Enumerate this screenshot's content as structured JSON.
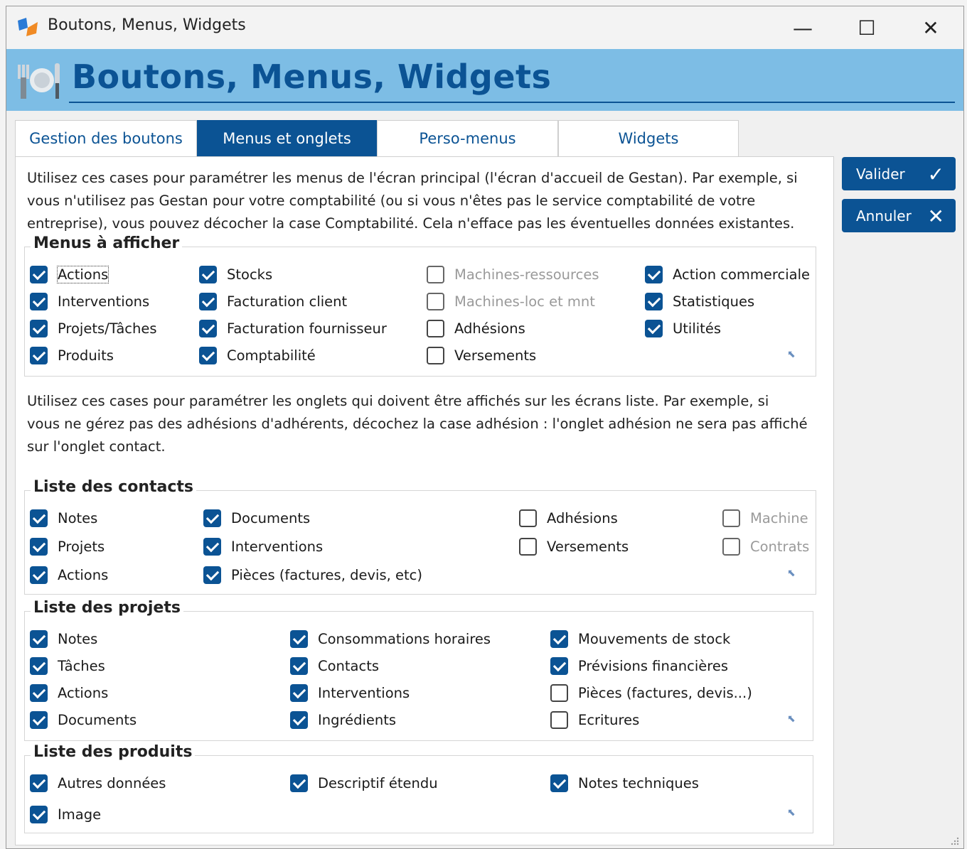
{
  "window": {
    "title": "Boutons, Menus, Widgets",
    "minimize": "—",
    "maximize": "☐",
    "close": "✕"
  },
  "banner": {
    "title": "Boutons, Menus, Widgets"
  },
  "tabs": [
    {
      "label": "Gestion des boutons"
    },
    {
      "label": "Menus et onglets"
    },
    {
      "label": "Perso-menus"
    },
    {
      "label": "Widgets"
    }
  ],
  "intro_menus": [
    "Utilisez ces cases pour paramétrer les menus de l'écran principal (l'écran d'accueil de Gestan). Par exemple, si",
    "vous n'utilisez pas Gestan pour votre comptabilité (ou si vous n'êtes pas le service comptabilité de votre",
    "entreprise), vous pouvez décocher la case Comptabilité. Cela n'efface pas les éventuelles données existantes."
  ],
  "intro_onglets": [
    "Utilisez ces cases pour paramétrer les onglets qui doivent être affichés sur les écrans liste. Par exemple, si",
    "vous ne gérez pas des adhésions d'adhérents, décochez la case adhésion : l'onglet adhésion ne sera pas affiché",
    "sur l'onglet contact."
  ],
  "groups": {
    "menus": {
      "title": "Menus à afficher",
      "items": [
        {
          "label": "Actions",
          "state": "on"
        },
        {
          "label": "Interventions",
          "state": "on"
        },
        {
          "label": "Projets/Tâches",
          "state": "on"
        },
        {
          "label": "Produits",
          "state": "on"
        },
        {
          "label": "Stocks",
          "state": "on"
        },
        {
          "label": "Facturation client",
          "state": "on"
        },
        {
          "label": "Facturation fournisseur",
          "state": "on"
        },
        {
          "label": "Comptabilité",
          "state": "on"
        },
        {
          "label": "Machines-ressources",
          "state": "disabled"
        },
        {
          "label": "Machines-loc et mnt",
          "state": "disabled"
        },
        {
          "label": "Adhésions",
          "state": "off"
        },
        {
          "label": "Versements",
          "state": "off"
        },
        {
          "label": "Action commerciale",
          "state": "on"
        },
        {
          "label": "Statistiques",
          "state": "on"
        },
        {
          "label": "Utilités",
          "state": "on"
        }
      ]
    },
    "contacts": {
      "title": "Liste des contacts",
      "items": [
        {
          "label": "Notes",
          "state": "on"
        },
        {
          "label": "Projets",
          "state": "on"
        },
        {
          "label": "Actions",
          "state": "on"
        },
        {
          "label": "Documents",
          "state": "on"
        },
        {
          "label": "Interventions",
          "state": "on"
        },
        {
          "label": "Pièces (factures, devis, etc)",
          "state": "on"
        },
        {
          "label": "Adhésions",
          "state": "off"
        },
        {
          "label": "Versements",
          "state": "off"
        },
        {
          "label": "Machine",
          "state": "disabled"
        },
        {
          "label": "Contrats",
          "state": "disabled"
        }
      ]
    },
    "projets": {
      "title": "Liste des projets",
      "items": [
        {
          "label": "Notes",
          "state": "on"
        },
        {
          "label": "Tâches",
          "state": "on"
        },
        {
          "label": "Actions",
          "state": "on"
        },
        {
          "label": "Documents",
          "state": "on"
        },
        {
          "label": "Consommations horaires",
          "state": "on"
        },
        {
          "label": "Contacts",
          "state": "on"
        },
        {
          "label": "Interventions",
          "state": "on"
        },
        {
          "label": "Ingrédients",
          "state": "on"
        },
        {
          "label": "Mouvements de stock",
          "state": "on"
        },
        {
          "label": "Prévisions financières",
          "state": "on"
        },
        {
          "label": "Pièces (factures, devis...)",
          "state": "off"
        },
        {
          "label": "Ecritures",
          "state": "off"
        }
      ]
    },
    "produits": {
      "title": "Liste des produits",
      "items": [
        {
          "label": "Autres données",
          "state": "on"
        },
        {
          "label": "Image",
          "state": "on"
        },
        {
          "label": "Descriptif étendu",
          "state": "on"
        },
        {
          "label": "Notes techniques",
          "state": "on"
        }
      ]
    }
  },
  "buttons": {
    "valider": "Valider",
    "annuler": "Annuler"
  },
  "colors": {
    "accent": "#0b5394",
    "banner": "#7dbde5"
  },
  "icons": {
    "pin": "pin-icon",
    "check": "check-icon",
    "cross": "cross-icon"
  }
}
